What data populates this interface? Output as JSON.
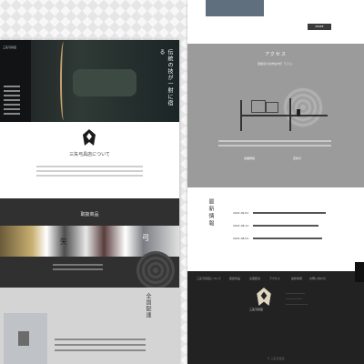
{
  "left": {
    "logo": "三矢弓具店",
    "hero_copy": "伝統の技が一射に宿る",
    "about_title": "三矢弓具店について",
    "products_title": "取扱商品",
    "product_cards": [
      "矢",
      "弓"
    ],
    "delivery_copy": "全国配達",
    "colors": {
      "dark": "#303030",
      "gold": "#c8b070"
    }
  },
  "right": {
    "top_button": "MORE",
    "access_title": "アクセス",
    "access_address": "愛媛県今治市伯方町「◯◯」",
    "access_labels": [
      "営業時間",
      "定休日"
    ],
    "news_title": "最新情報",
    "news": [
      {
        "date": "2021.09.01"
      },
      {
        "date": "2021.08.11"
      },
      {
        "date": "2021.08.01"
      }
    ],
    "footer_nav": [
      "三矢弓具店について",
      "取扱商品",
      "全国配達",
      "アクセス",
      "最新情報",
      "お問い合わせ"
    ],
    "footer_name": "三矢弓具店",
    "copyright": "© 三矢弓具店"
  }
}
